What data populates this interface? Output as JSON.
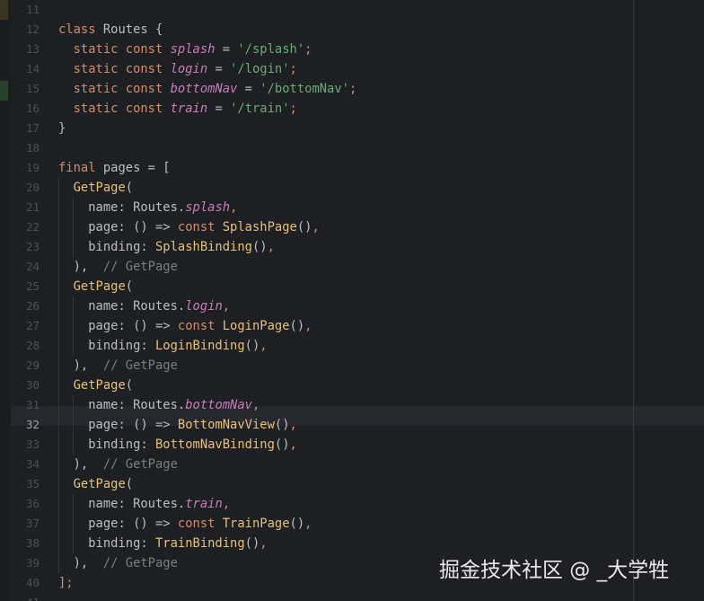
{
  "editor": {
    "current_line": "32",
    "colors": {
      "background": "#1e1f22",
      "current_line": "#26282e",
      "keyword": "#cf8e6d",
      "field": "#c77dbb",
      "string": "#6aab73",
      "function": "#e6c17a",
      "comment": "#7a7e85",
      "text": "#bcbec4",
      "line_number": "#4b5059"
    },
    "lines": [
      {
        "number": "11",
        "tokens": []
      },
      {
        "number": "12",
        "tokens": [
          {
            "t": "class ",
            "c": "kw"
          },
          {
            "t": "Routes {",
            "c": "plain"
          }
        ]
      },
      {
        "number": "13",
        "tokens": [
          {
            "t": "  static const ",
            "c": "kw"
          },
          {
            "t": "splash",
            "c": "field"
          },
          {
            "t": " = ",
            "c": "plain"
          },
          {
            "t": "'/splash'",
            "c": "str"
          },
          {
            "t": ";",
            "c": "kw"
          }
        ]
      },
      {
        "number": "14",
        "tokens": [
          {
            "t": "  static const ",
            "c": "kw"
          },
          {
            "t": "login",
            "c": "field"
          },
          {
            "t": " = ",
            "c": "plain"
          },
          {
            "t": "'/login'",
            "c": "str"
          },
          {
            "t": ";",
            "c": "kw"
          }
        ]
      },
      {
        "number": "15",
        "tokens": [
          {
            "t": "  static const ",
            "c": "kw"
          },
          {
            "t": "bottomNav",
            "c": "field"
          },
          {
            "t": " = ",
            "c": "plain"
          },
          {
            "t": "'/bottomNav'",
            "c": "str"
          },
          {
            "t": ";",
            "c": "kw"
          }
        ]
      },
      {
        "number": "16",
        "tokens": [
          {
            "t": "  static const ",
            "c": "kw"
          },
          {
            "t": "train",
            "c": "field"
          },
          {
            "t": " = ",
            "c": "plain"
          },
          {
            "t": "'/train'",
            "c": "str"
          },
          {
            "t": ";",
            "c": "kw"
          }
        ]
      },
      {
        "number": "17",
        "tokens": [
          {
            "t": "}",
            "c": "plain"
          }
        ]
      },
      {
        "number": "18",
        "tokens": []
      },
      {
        "number": "19",
        "tokens": [
          {
            "t": "final ",
            "c": "kw"
          },
          {
            "t": "pages = [",
            "c": "plain"
          }
        ]
      },
      {
        "number": "20",
        "tokens": [
          {
            "t": "  ",
            "c": "plain"
          },
          {
            "t": "GetPage",
            "c": "fn"
          },
          {
            "t": "(",
            "c": "plain"
          }
        ]
      },
      {
        "number": "21",
        "tokens": [
          {
            "t": "    name: Routes.",
            "c": "plain"
          },
          {
            "t": "splash",
            "c": "field"
          },
          {
            "t": ",",
            "c": "kw"
          }
        ]
      },
      {
        "number": "22",
        "tokens": [
          {
            "t": "    page: () => ",
            "c": "plain"
          },
          {
            "t": "const ",
            "c": "kw"
          },
          {
            "t": "SplashPage",
            "c": "fn"
          },
          {
            "t": "()",
            "c": "plain"
          },
          {
            "t": ",",
            "c": "kw"
          }
        ]
      },
      {
        "number": "23",
        "tokens": [
          {
            "t": "    binding: ",
            "c": "plain"
          },
          {
            "t": "SplashBinding",
            "c": "fn"
          },
          {
            "t": "()",
            "c": "plain"
          },
          {
            "t": ",",
            "c": "kw"
          }
        ]
      },
      {
        "number": "24",
        "tokens": [
          {
            "t": "  ),  ",
            "c": "plain"
          },
          {
            "t": "// GetPage",
            "c": "comment"
          }
        ]
      },
      {
        "number": "25",
        "tokens": [
          {
            "t": "  ",
            "c": "plain"
          },
          {
            "t": "GetPage",
            "c": "fn"
          },
          {
            "t": "(",
            "c": "plain"
          }
        ]
      },
      {
        "number": "26",
        "tokens": [
          {
            "t": "    name: Routes.",
            "c": "plain"
          },
          {
            "t": "login",
            "c": "field"
          },
          {
            "t": ",",
            "c": "kw"
          }
        ]
      },
      {
        "number": "27",
        "tokens": [
          {
            "t": "    page: () => ",
            "c": "plain"
          },
          {
            "t": "const ",
            "c": "kw"
          },
          {
            "t": "LoginPage",
            "c": "fn"
          },
          {
            "t": "()",
            "c": "plain"
          },
          {
            "t": ",",
            "c": "kw"
          }
        ]
      },
      {
        "number": "28",
        "tokens": [
          {
            "t": "    binding: ",
            "c": "plain"
          },
          {
            "t": "LoginBinding",
            "c": "fn"
          },
          {
            "t": "()",
            "c": "plain"
          },
          {
            "t": ",",
            "c": "kw"
          }
        ]
      },
      {
        "number": "29",
        "tokens": [
          {
            "t": "  ),  ",
            "c": "plain"
          },
          {
            "t": "// GetPage",
            "c": "comment"
          }
        ]
      },
      {
        "number": "30",
        "tokens": [
          {
            "t": "  ",
            "c": "plain"
          },
          {
            "t": "GetPage",
            "c": "fn"
          },
          {
            "t": "(",
            "c": "plain"
          }
        ]
      },
      {
        "number": "31",
        "tokens": [
          {
            "t": "    name: Routes.",
            "c": "plain"
          },
          {
            "t": "bottomNav",
            "c": "field"
          },
          {
            "t": ",",
            "c": "kw"
          }
        ]
      },
      {
        "number": "32",
        "tokens": [
          {
            "t": "    page: () => ",
            "c": "plain"
          },
          {
            "t": "BottomNavView",
            "c": "fn"
          },
          {
            "t": "()",
            "c": "plain"
          },
          {
            "t": ",",
            "c": "kw"
          }
        ]
      },
      {
        "number": "33",
        "tokens": [
          {
            "t": "    binding: ",
            "c": "plain"
          },
          {
            "t": "BottomNavBinding",
            "c": "fn"
          },
          {
            "t": "()",
            "c": "plain"
          },
          {
            "t": ",",
            "c": "kw"
          }
        ]
      },
      {
        "number": "34",
        "tokens": [
          {
            "t": "  ),  ",
            "c": "plain"
          },
          {
            "t": "// GetPage",
            "c": "comment"
          }
        ]
      },
      {
        "number": "35",
        "tokens": [
          {
            "t": "  ",
            "c": "plain"
          },
          {
            "t": "GetPage",
            "c": "fn"
          },
          {
            "t": "(",
            "c": "plain"
          }
        ]
      },
      {
        "number": "36",
        "tokens": [
          {
            "t": "    name: Routes.",
            "c": "plain"
          },
          {
            "t": "train",
            "c": "field"
          },
          {
            "t": ",",
            "c": "kw"
          }
        ]
      },
      {
        "number": "37",
        "tokens": [
          {
            "t": "    page: () => ",
            "c": "plain"
          },
          {
            "t": "const ",
            "c": "kw"
          },
          {
            "t": "TrainPage",
            "c": "fn"
          },
          {
            "t": "()",
            "c": "plain"
          },
          {
            "t": ",",
            "c": "kw"
          }
        ]
      },
      {
        "number": "38",
        "tokens": [
          {
            "t": "    binding: ",
            "c": "plain"
          },
          {
            "t": "TrainBinding",
            "c": "fn"
          },
          {
            "t": "()",
            "c": "plain"
          },
          {
            "t": ",",
            "c": "kw"
          }
        ]
      },
      {
        "number": "39",
        "tokens": [
          {
            "t": "  ),  ",
            "c": "plain"
          },
          {
            "t": "// GetPage",
            "c": "comment"
          }
        ]
      },
      {
        "number": "40",
        "tokens": [
          {
            "t": "];",
            "c": "kw"
          }
        ]
      },
      {
        "number": "41",
        "tokens": []
      }
    ]
  },
  "watermark": {
    "text": "掘金技术社区 @ _大学牲"
  }
}
